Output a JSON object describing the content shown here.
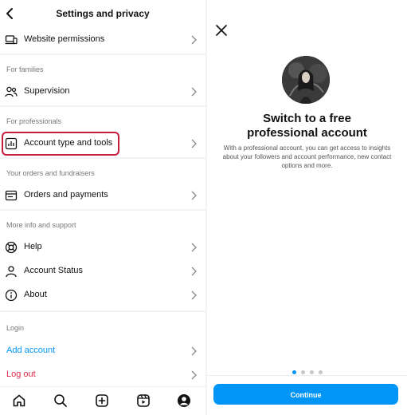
{
  "left": {
    "title": "Settings and privacy",
    "rows": [
      {
        "label": "Website permissions"
      },
      {
        "label": "Supervision"
      },
      {
        "label": "Account type and tools"
      },
      {
        "label": "Orders and payments"
      },
      {
        "label": "Help"
      },
      {
        "label": "Account Status"
      },
      {
        "label": "About"
      },
      {
        "label": "Add account"
      },
      {
        "label": "Log out"
      }
    ],
    "sections": [
      "For families",
      "For professionals",
      "Your orders and fundraisers",
      "More info and support",
      "Login"
    ],
    "colors": {
      "highlight": "#c41e3a",
      "accent": "#0095f6",
      "logout": "#e0294a"
    }
  },
  "right": {
    "headline_line1": "Switch to a free",
    "headline_line2": "professional account",
    "description": "With a professional account, you can get access to insights about your followers and account performance, new contact options and more.",
    "continue_label": "Continue"
  }
}
